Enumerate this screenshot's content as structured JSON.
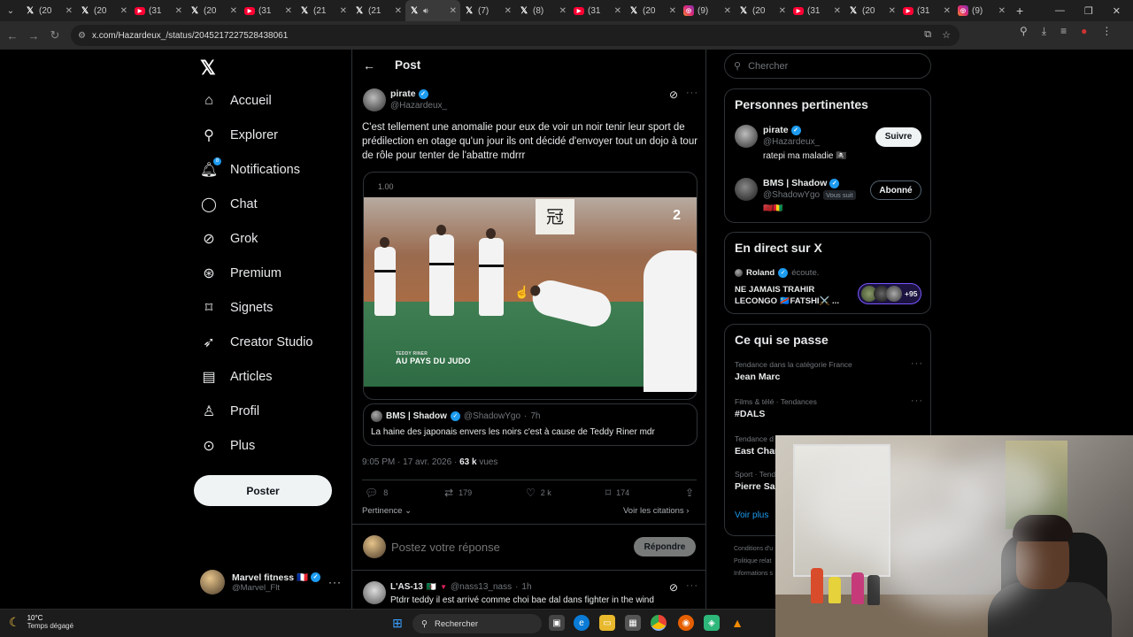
{
  "browser": {
    "tabs": [
      {
        "icon": "x-icon",
        "label": "(20"
      },
      {
        "icon": "x-icon",
        "label": "(20"
      },
      {
        "icon": "youtube-icon",
        "label": "(31"
      },
      {
        "icon": "x-icon",
        "label": "(20"
      },
      {
        "icon": "youtube-icon",
        "label": "(31"
      },
      {
        "icon": "x-icon",
        "label": "(21"
      },
      {
        "icon": "x-icon",
        "label": "(21"
      },
      {
        "icon": "x-icon",
        "label": "",
        "active": true
      },
      {
        "icon": "x-icon",
        "label": "(7)"
      },
      {
        "icon": "x-icon",
        "label": "(8)"
      },
      {
        "icon": "youtube-icon",
        "label": "(31"
      },
      {
        "icon": "x-icon",
        "label": "(20"
      },
      {
        "icon": "instagram-icon",
        "label": "(9)"
      },
      {
        "icon": "x-icon",
        "label": "(20"
      },
      {
        "icon": "youtube-icon",
        "label": "(31"
      },
      {
        "icon": "x-icon",
        "label": "(20"
      },
      {
        "icon": "youtube-icon",
        "label": "(31"
      },
      {
        "icon": "instagram-icon",
        "label": "(9)"
      }
    ],
    "url": "x.com/Hazardeux_/status/2045217227528438061"
  },
  "nav": {
    "items": [
      {
        "label": "Accueil",
        "icon": "home-icon"
      },
      {
        "label": "Explorer",
        "icon": "search-icon"
      },
      {
        "label": "Notifications",
        "icon": "bell-icon",
        "badge": "8"
      },
      {
        "label": "Chat",
        "icon": "chat-icon"
      },
      {
        "label": "Grok",
        "icon": "grok-icon"
      },
      {
        "label": "Premium",
        "icon": "premium-icon"
      },
      {
        "label": "Signets",
        "icon": "bookmark-icon"
      },
      {
        "label": "Creator Studio",
        "icon": "rocket-icon"
      },
      {
        "label": "Articles",
        "icon": "article-icon"
      },
      {
        "label": "Profil",
        "icon": "person-icon"
      },
      {
        "label": "Plus",
        "icon": "more-icon"
      }
    ],
    "post_button": "Poster",
    "account": {
      "name": "Marvel fitness 🇫🇷",
      "handle": "@Marvel_Flt"
    }
  },
  "post": {
    "header_title": "Post",
    "author_name": "pirate",
    "author_handle": "@Hazardeux_",
    "text": "C'est tellement une anomalie pour eux de voir un noir  tenir leur sport de prédilection en otage qu'un jour ils ont décidé d'envoyer tout un dojo à tour de rôle pour tenter de l'abattre mdrrr",
    "video": {
      "speed": "1.00",
      "channel_logo": "2",
      "caption_small": "TEDDY RINER",
      "caption": "AU PAYS DU JUDO",
      "scroll_glyph": "冠"
    },
    "quote": {
      "name": "BMS | Shadow",
      "handle": "@ShadowYgo",
      "time": "7h",
      "text": "La haine des japonais envers les noirs c'est à cause de Teddy Riner mdr"
    },
    "timestamp": "9:05 PM · 17 avr. 2026 ·",
    "views_count": "63 k",
    "views_label": "vues",
    "stats": {
      "replies": "8",
      "reposts": "179",
      "likes": "2 k",
      "bookmarks": "174"
    },
    "sort_label": "Pertinence",
    "quotes_link": "Voir les citations",
    "reply_placeholder": "Postez votre réponse",
    "reply_button": "Répondre",
    "next_reply": {
      "name": "L'AS-13",
      "handle": "@nass13_nass",
      "time": "1h",
      "text": "Ptdrr teddy il est arrivé comme choi bae dal dans fighter in the wind"
    }
  },
  "sidebar": {
    "search_placeholder": "Chercher",
    "relevant": {
      "title": "Personnes pertinentes",
      "people": [
        {
          "name": "pirate",
          "handle": "@Hazardeux_",
          "bio": "ratepi ma maladie 🏴‍☠️",
          "button": "Suivre"
        },
        {
          "name": "BMS | Shadow",
          "handle": "@ShadowYgo",
          "follows_you": "Vous suit",
          "bio": "🇲🇦🇬🇳",
          "button": "Abonné"
        }
      ]
    },
    "live": {
      "title": "En direct sur X",
      "host": "Roland",
      "status": "écoute.",
      "space_title": "NE JAMAIS TRAHIR LECONGO 🇨🇩FATSHI⚔️ ...",
      "listeners": "+95"
    },
    "trends": {
      "title": "Ce qui se passe",
      "items": [
        {
          "context": "Tendance dans la catégorie France",
          "name": "Jean Marc"
        },
        {
          "context": "Films & télé · Tendances",
          "name": "#DALS"
        },
        {
          "context": "Tendance d",
          "name": "East Chan"
        },
        {
          "context": "Sport · Tend",
          "name": "Pierre Sag"
        }
      ],
      "show_more": "Voir plus"
    },
    "footer": [
      "Conditions d'u",
      "Politique relat",
      "Informations s"
    ]
  },
  "taskbar": {
    "temp": "10°C",
    "weather": "Temps dégagé",
    "search": "Rechercher"
  }
}
